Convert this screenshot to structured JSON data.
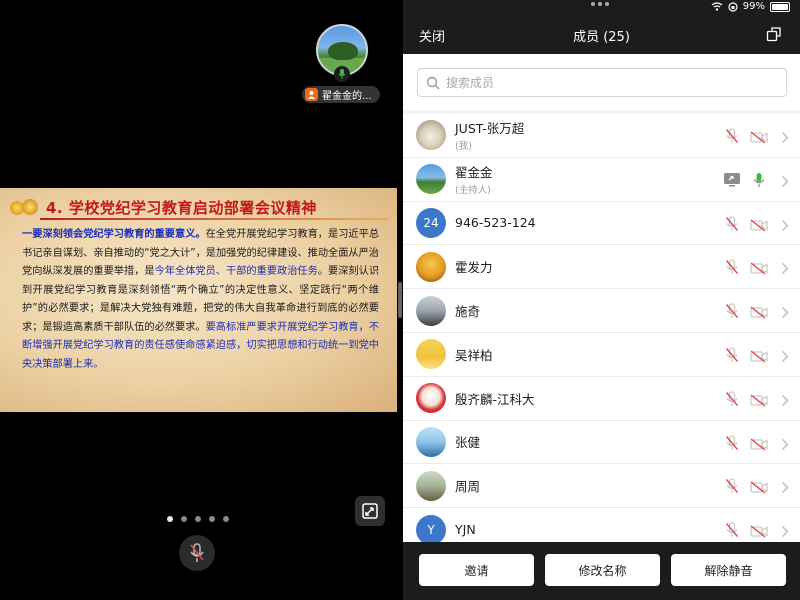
{
  "meeting_view": {
    "active_speaker_name": "翟金金的...",
    "slide": {
      "title": "4. 学校党纪学习教育启动部署会议精神",
      "body_segments": [
        {
          "text": "一要深刻领会党纪学习教育的重要意义。",
          "style": "blue"
        },
        {
          "text": "在全党开展党纪学习教育，是习近平总书记亲自谋划、亲自推动的“党之大计”，是加强党的纪律建设、推动全面从严治党向纵深发展的重要举措，是",
          "style": "plain"
        },
        {
          "text": "今年全体党员、干部的重要政治任务",
          "style": "blue-n"
        },
        {
          "text": "。要深刻认识到开展党纪学习教育是深刻领悟“两个确立”的决定性意义、坚定践行“两个维护”的必然要求；是解决大党独有难题，把党的伟大自我革命进行到底的必然要求；是锻造高素质干部队伍的必然要求。",
          "style": "plain"
        },
        {
          "text": "要高标准严要求开展党纪学习教育，不断增强开展党纪学习教育的责任感使命感紧迫感，切实把思想和行动统一到党中央决策部署上来。",
          "style": "blue-n"
        }
      ]
    },
    "page_count": 5,
    "active_page": 1
  },
  "status_bar": {
    "battery": "99%"
  },
  "panel": {
    "close_label": "关闭",
    "title": "成员 (25)",
    "search_placeholder": "搜索成员",
    "members": [
      {
        "name": "JUST-张万超",
        "sub": "(我)",
        "avatar": "photo-cat",
        "mic": "muted",
        "cam": "off"
      },
      {
        "name": "翟金金",
        "sub": "(主持人)",
        "avatar": "photo-landscape",
        "mic": "on",
        "cam": "sharing"
      },
      {
        "name": "946-523-124",
        "sub": "",
        "avatar": "text",
        "avatar_text": "24",
        "avatar_color": "#3d77c9",
        "mic": "muted",
        "cam": "off"
      },
      {
        "name": "霍发力",
        "sub": "",
        "avatar": "photo-cartoon",
        "mic": "muted",
        "cam": "off"
      },
      {
        "name": "施奇",
        "sub": "",
        "avatar": "photo-person",
        "mic": "muted",
        "cam": "off"
      },
      {
        "name": "吴祥柏",
        "sub": "",
        "avatar": "photo-yellow",
        "mic": "muted",
        "cam": "off"
      },
      {
        "name": "殷齐麟-江科大",
        "sub": "",
        "avatar": "photo-doll",
        "mic": "muted",
        "cam": "off"
      },
      {
        "name": "张健",
        "sub": "",
        "avatar": "photo-sea",
        "mic": "muted",
        "cam": "off"
      },
      {
        "name": "周周",
        "sub": "",
        "avatar": "photo-outdoor",
        "mic": "muted",
        "cam": "off"
      },
      {
        "name": "YJN",
        "sub": "",
        "avatar": "text",
        "avatar_text": "Y",
        "avatar_color": "#3d77c9",
        "mic": "muted",
        "cam": "off"
      }
    ],
    "footer_buttons": [
      "邀请",
      "修改名称",
      "解除静音"
    ]
  },
  "colors": {
    "muted_red": "#e04b4b",
    "mic_green": "#3cbf4a",
    "slide_title_red": "#c3171b",
    "slide_blue": "#1b2db8"
  }
}
